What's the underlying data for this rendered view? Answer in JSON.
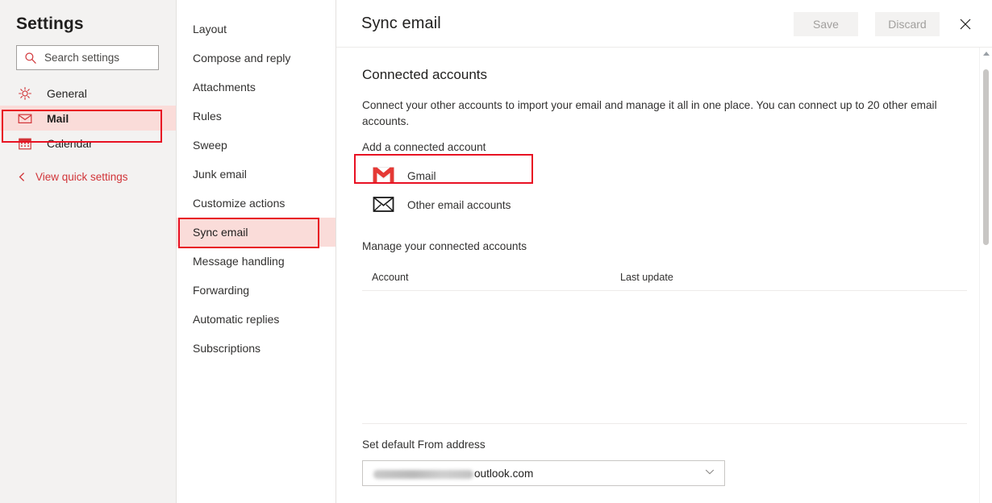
{
  "sidebar": {
    "title": "Settings",
    "search": {
      "placeholder": "Search settings",
      "icon": "search-icon"
    },
    "items": [
      {
        "label": "General",
        "icon": "gear-icon",
        "selected": false
      },
      {
        "label": "Mail",
        "icon": "envelope-icon",
        "selected": true
      },
      {
        "label": "Calendar",
        "icon": "calendar-icon",
        "selected": false
      }
    ],
    "quick_settings": {
      "label": "View quick settings",
      "icon": "chevron-left-icon"
    }
  },
  "subnav": {
    "items": [
      {
        "label": "Layout",
        "selected": false
      },
      {
        "label": "Compose and reply",
        "selected": false
      },
      {
        "label": "Attachments",
        "selected": false
      },
      {
        "label": "Rules",
        "selected": false
      },
      {
        "label": "Sweep",
        "selected": false
      },
      {
        "label": "Junk email",
        "selected": false
      },
      {
        "label": "Customize actions",
        "selected": false
      },
      {
        "label": "Sync email",
        "selected": true
      },
      {
        "label": "Message handling",
        "selected": false
      },
      {
        "label": "Forwarding",
        "selected": false
      },
      {
        "label": "Automatic replies",
        "selected": false
      },
      {
        "label": "Subscriptions",
        "selected": false
      }
    ]
  },
  "header": {
    "title": "Sync email",
    "save_label": "Save",
    "discard_label": "Discard",
    "close_icon": "close-icon",
    "save_enabled": false,
    "discard_enabled": false
  },
  "connected_accounts": {
    "heading": "Connected accounts",
    "description": "Connect your other accounts to import your email and manage it all in one place. You can connect up to 20 other email accounts.",
    "add_label": "Add a connected account",
    "options": [
      {
        "label": "Gmail",
        "icon": "gmail-icon",
        "highlighted": true
      },
      {
        "label": "Other email accounts",
        "icon": "envelope-icon",
        "highlighted": false
      }
    ],
    "manage_label": "Manage your connected accounts",
    "table": {
      "columns": [
        "Account",
        "Last update"
      ],
      "rows": []
    }
  },
  "from_address": {
    "label": "Set default From address",
    "selected_value": "outlook.com",
    "value_is_redacted": true,
    "chevron_icon": "chevron-down-icon"
  },
  "scrollbar": {
    "up_arrow_icon": "caret-up-icon"
  },
  "colors": {
    "accent_red": "#d13438",
    "highlight_pink": "#fadcd9",
    "annotation_red": "#e81123",
    "sidebar_bg": "#f3f2f1",
    "text_primary": "#201f1e",
    "text_secondary": "#323130",
    "disabled_text": "#a19f9d"
  }
}
